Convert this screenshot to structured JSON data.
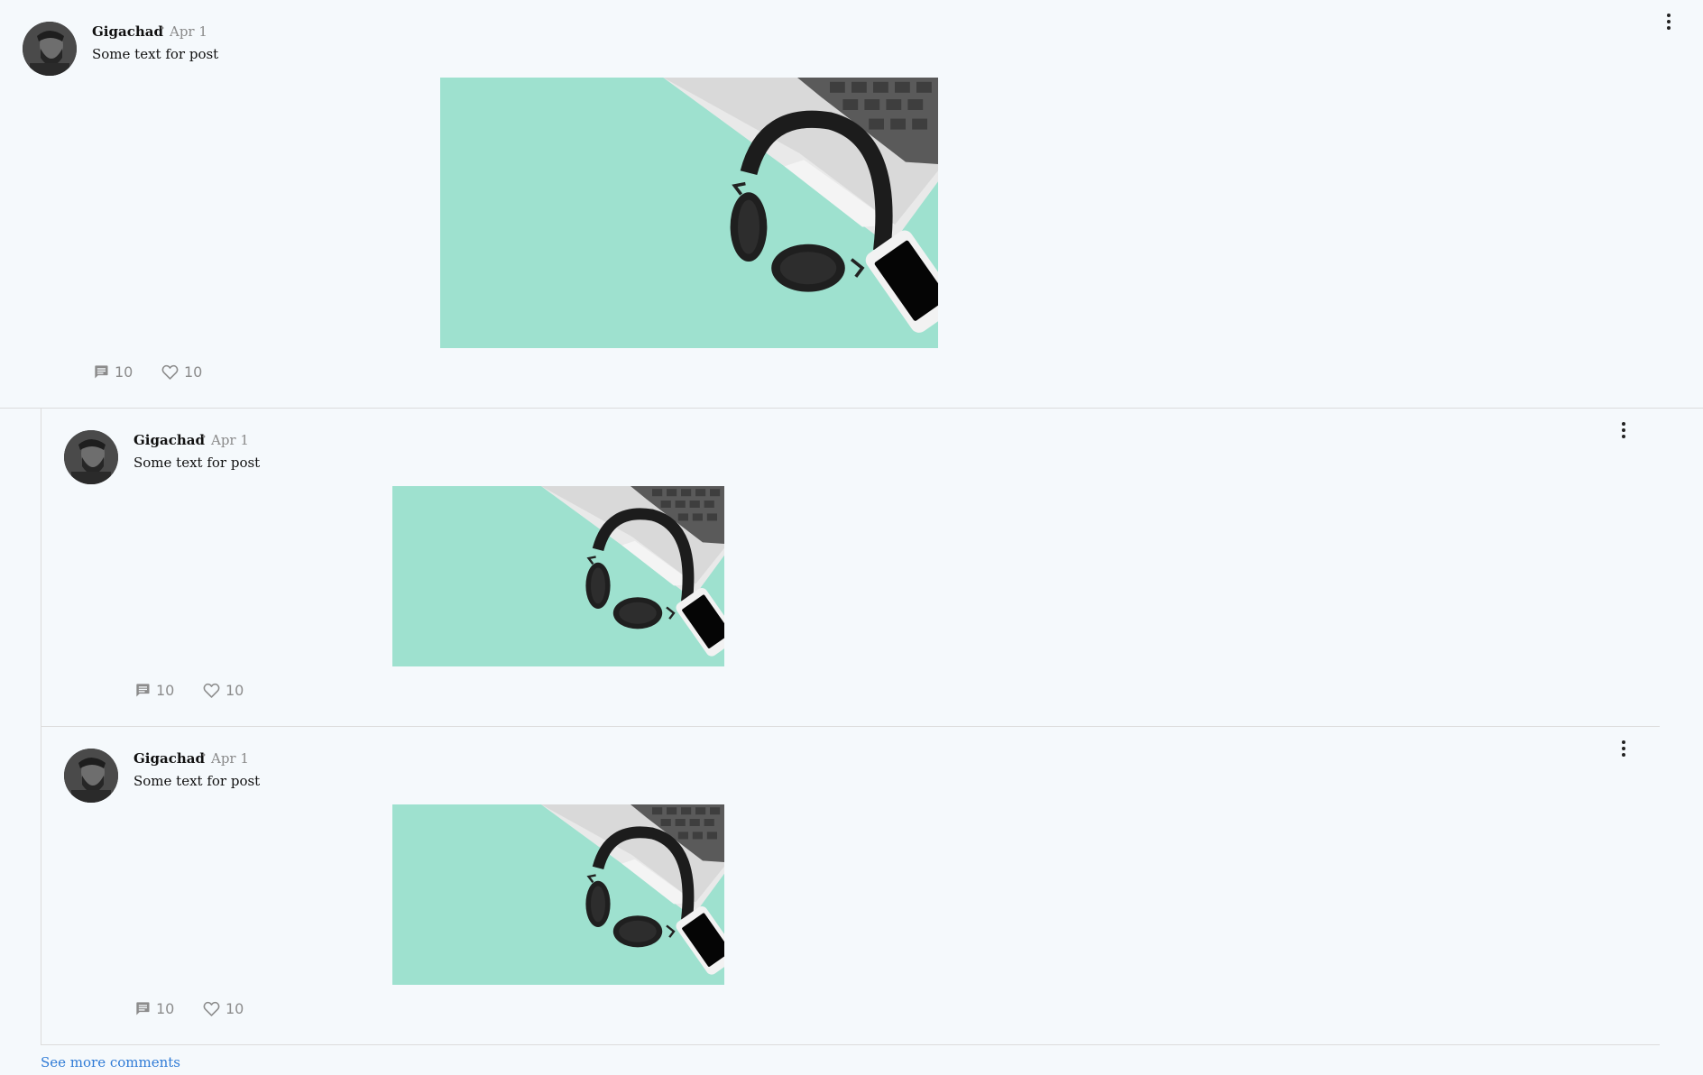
{
  "posts": [
    {
      "author": "Gigachad",
      "separator": "•",
      "date": "Apr 1",
      "text": "Some text for post",
      "comments": "10",
      "likes": "10",
      "icons": {
        "comment": "comment-icon",
        "like": "heart-icon",
        "menu": "more-vert-icon"
      }
    }
  ],
  "comments": [
    {
      "author": "Gigachad",
      "separator": "•",
      "date": "Apr 1",
      "text": "Some text for post",
      "comments": "10",
      "likes": "10"
    },
    {
      "author": "Gigachad",
      "separator": "•",
      "date": "Apr 1",
      "text": "Some text for post",
      "comments": "10",
      "likes": "10"
    }
  ],
  "footer": {
    "see_more": "See more comments"
  },
  "colors": {
    "background": "#f5f9fc",
    "image_mint": "#9ee1cf",
    "link": "#2f7bd6",
    "divider": "#dcdcdc"
  }
}
